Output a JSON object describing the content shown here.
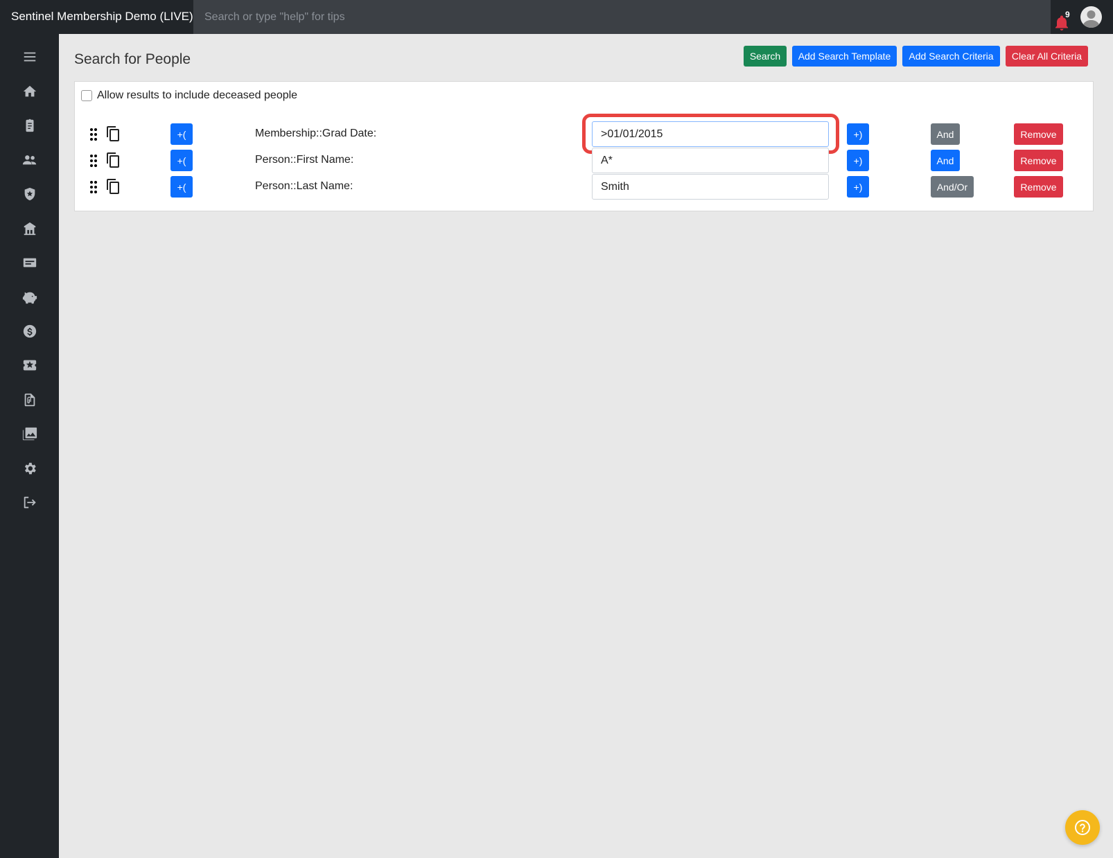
{
  "app": {
    "title": "Sentinel Membership Demo (LIVE)",
    "search_placeholder": "Search or type \"help\" for tips",
    "notification_count": "9"
  },
  "sidebar": {
    "items": [
      {
        "icon": "menu-icon"
      },
      {
        "icon": "home-icon"
      },
      {
        "icon": "clipboard-icon"
      },
      {
        "icon": "people-icon"
      },
      {
        "icon": "shield-star-icon"
      },
      {
        "icon": "building-icon"
      },
      {
        "icon": "id-card-icon"
      },
      {
        "icon": "piggy-bank-icon"
      },
      {
        "icon": "dollar-icon"
      },
      {
        "icon": "ticket-icon"
      },
      {
        "icon": "attachment-file-icon"
      },
      {
        "icon": "images-icon"
      },
      {
        "icon": "gear-icon"
      },
      {
        "icon": "logout-icon"
      }
    ]
  },
  "main": {
    "title": "Search for People",
    "toolbar": {
      "search_label": "Search",
      "add_template_label": "Add Search Template",
      "add_criteria_label": "Add Search Criteria",
      "clear_label": "Clear All Criteria"
    },
    "deceased_label": "Allow results to include deceased people",
    "criteria": [
      {
        "open_paren": "+(",
        "label": "Membership::Grad Date:",
        "value": ">01/01/2015",
        "close_paren": "+)",
        "logic": "And",
        "logic_color": "#6c757d",
        "remove": "Remove"
      },
      {
        "open_paren": "+(",
        "label": "Person::First Name:",
        "value": "A*",
        "close_paren": "+)",
        "logic": "And",
        "logic_color": "#0d6efd",
        "remove": "Remove"
      },
      {
        "open_paren": "+(",
        "label": "Person::Last Name:",
        "value": "Smith",
        "close_paren": "+)",
        "logic": "And/Or",
        "logic_color": "#6c757d",
        "remove": "Remove"
      }
    ]
  },
  "colors": {
    "highlight": "#e8433f",
    "primary": "#0d6efd",
    "success": "#198754",
    "danger": "#dc3545",
    "help": "#f5b81c"
  }
}
